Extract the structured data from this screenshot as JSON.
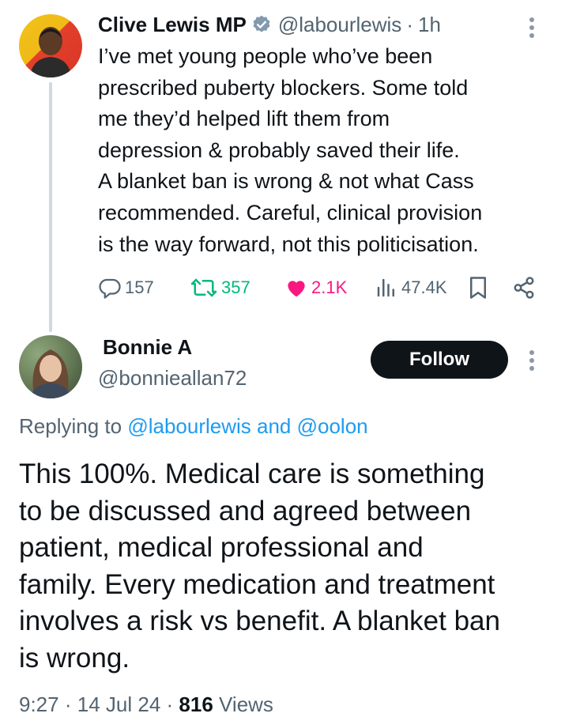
{
  "parent_tweet": {
    "display_name": "Clive Lewis MP",
    "verified": true,
    "handle": "@labourlewis",
    "separator": "·",
    "time": "1h",
    "avatar_icon": "avatar-image",
    "text": "I’ve met young  people who’ve been\nprescribed puberty blockers. Some told\nme they’d helped lift them from\ndepression & probably saved their life.\nA blanket ban is wrong & not what Cass\nrecommended. Careful, clinical provision\nis the way forward, not this politicisation.",
    "actions": {
      "replies": "157",
      "reposts": "357",
      "likes": "2.1K",
      "views": "47.4K"
    }
  },
  "reply": {
    "display_name": "Bonnie A",
    "handle": "@bonnieallan72",
    "follow_label": "Follow",
    "replying_prefix": "Replying to ",
    "replying_to_1": "@labourlewis",
    "replying_and": " and ",
    "replying_to_2": "@oolon",
    "text": "This 100%. Medical care is something\nto be discussed and agreed between\npatient, medical professional and\nfamily. Every medication and treatment\ninvolves a risk vs benefit. A blanket ban\nis wrong.",
    "time": "9:27",
    "date": "14 Jul 24",
    "separator": "·",
    "view_count": "816",
    "views_label": "Views"
  },
  "colors": {
    "text_primary": "#0f1419",
    "text_secondary": "#536471",
    "link": "#1d9bf0",
    "repost_green": "#00ba7c",
    "like_pink": "#f91880",
    "verified_gray": "#829aab",
    "thread_line": "#cfd9de"
  }
}
